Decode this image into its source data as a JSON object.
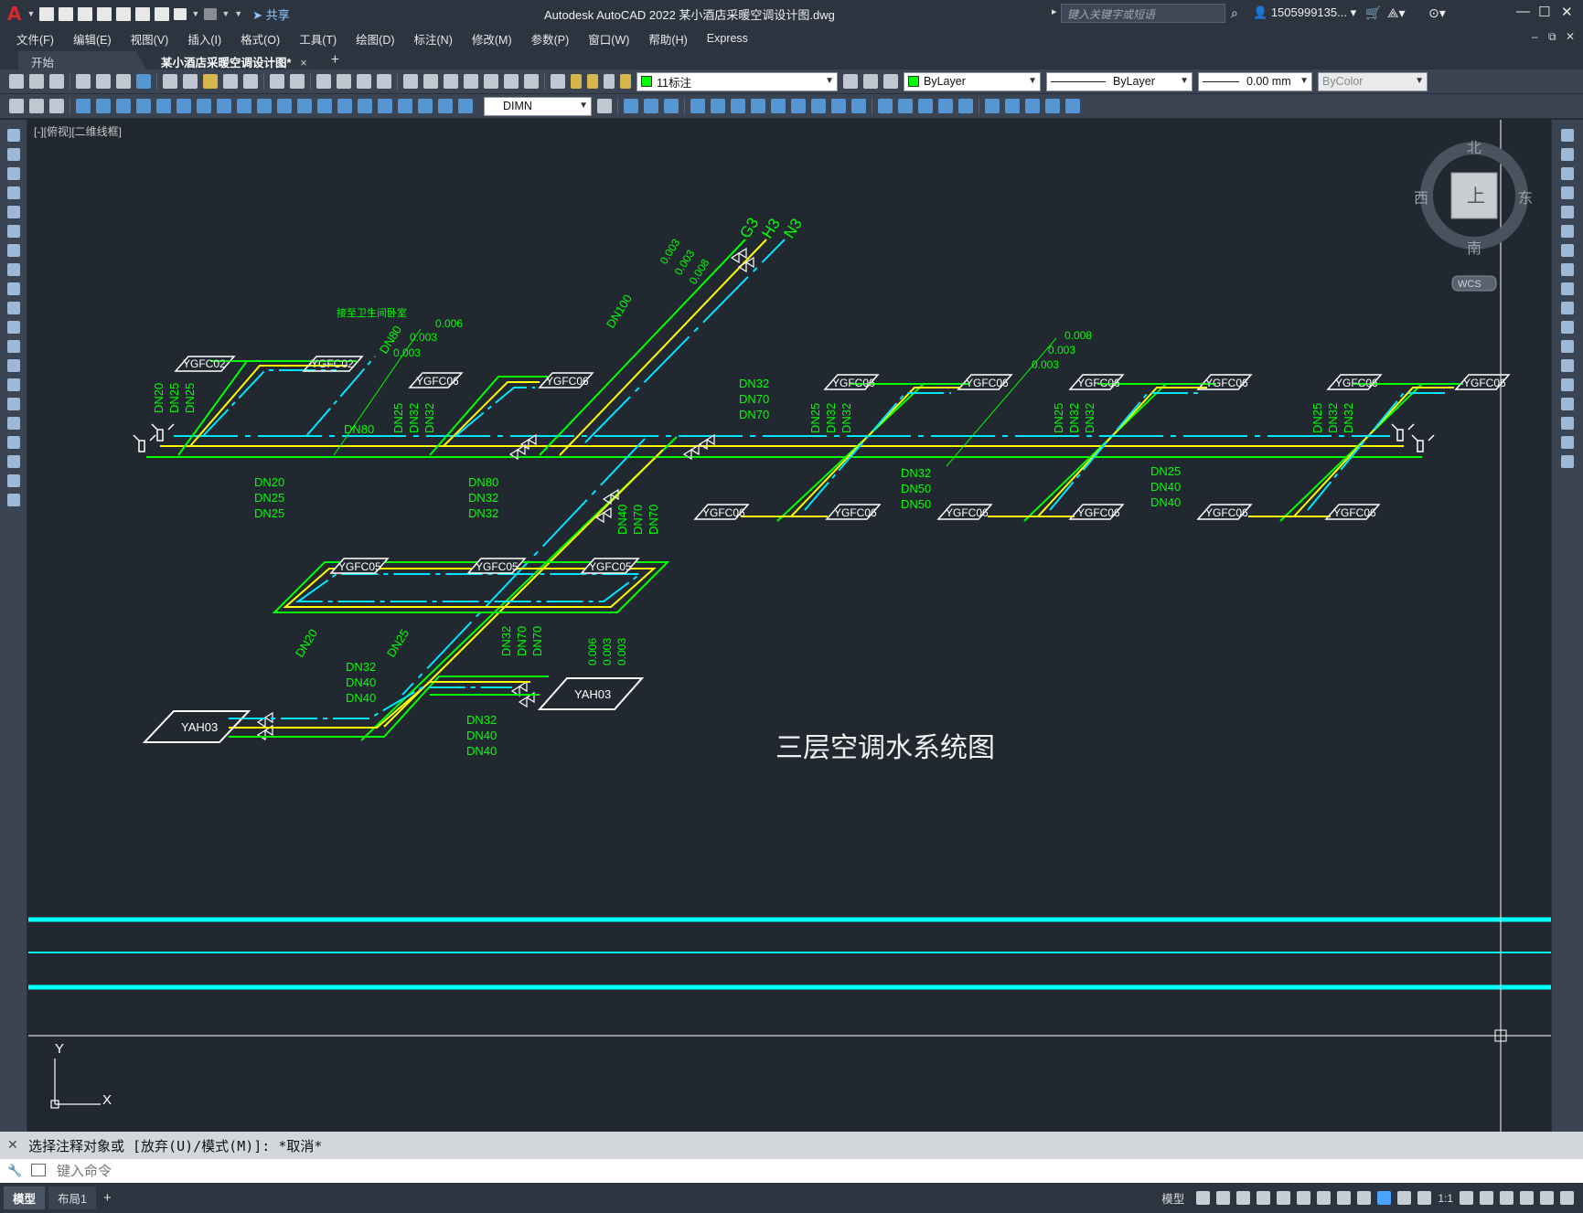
{
  "app": {
    "logo": "A",
    "window_title": "Autodesk AutoCAD 2022    某小酒店采暖空调设计图.dwg",
    "share_label": "共享",
    "search_placeholder": "键入关键字或短语",
    "user": "1505999135...",
    "help": "?"
  },
  "menu": [
    "文件(F)",
    "编辑(E)",
    "视图(V)",
    "插入(I)",
    "格式(O)",
    "工具(T)",
    "绘图(D)",
    "标注(N)",
    "修改(M)",
    "参数(P)",
    "窗口(W)",
    "帮助(H)",
    "Express"
  ],
  "tabs": {
    "start": "开始",
    "active": "某小酒店采暖空调设计图*",
    "close": "×",
    "add": "+"
  },
  "toolbar": {
    "layer": "11标注",
    "color": "ByLayer",
    "linetype": "ByLayer",
    "lineweight": "0.00 mm",
    "plotstyle": "ByColor",
    "dimstyle": "DIMN"
  },
  "viewcube": {
    "north": "北",
    "south": "南",
    "east": "东",
    "west": "西",
    "top": "上",
    "wcs": "WCS"
  },
  "viewport_label": "[-][俯视][二维线框]",
  "drawing": {
    "title": "三层空调水系统图",
    "ucs": {
      "y": "Y",
      "x": "X"
    },
    "risers": [
      "G3",
      "H3",
      "N3"
    ],
    "units": {
      "ygfc02": "YGFC02",
      "ygfc06": "YGFC06",
      "ygfc05": "YGFC05",
      "yah03": "YAH03"
    },
    "labels": {
      "dn80": "DN80",
      "dn100": "DN100",
      "dn80b": "DN80",
      "dn20_25_25": [
        "DN20",
        "DN25",
        "DN25"
      ],
      "dn80_32_32": [
        "DN80",
        "DN32",
        "DN32"
      ],
      "dn32_70_70": [
        "DN32",
        "DN70",
        "DN70"
      ],
      "dn32_50_50": [
        "DN32",
        "DN50",
        "DN50"
      ],
      "dn25_40_40": [
        "DN25",
        "DN40",
        "DN40"
      ],
      "dn32_40_40": [
        "DN32",
        "DN40",
        "DN40"
      ],
      "dn40_70_70": [
        "DN40",
        "DN70",
        "DN70"
      ],
      "dn25_32_32": [
        "DN25",
        "DN32",
        "DN32"
      ],
      "dn20_25_25_v": [
        "DN20",
        "DN25",
        "DN25"
      ],
      "dn32_70_70_v": [
        "DN32",
        "DN70",
        "DN70"
      ],
      "slope_006": "0.006",
      "slope_003": "0.003",
      "slope_008": "0.008",
      "note": "接至卫生间卧室"
    }
  },
  "command": {
    "history": "选择注释对象或 [放弃(U)/模式(M)]: *取消*",
    "placeholder": "键入命令"
  },
  "status": {
    "model_tab": "模型",
    "layout_tab": "布局1",
    "add": "+",
    "model": "模型",
    "scale": "1:1"
  }
}
